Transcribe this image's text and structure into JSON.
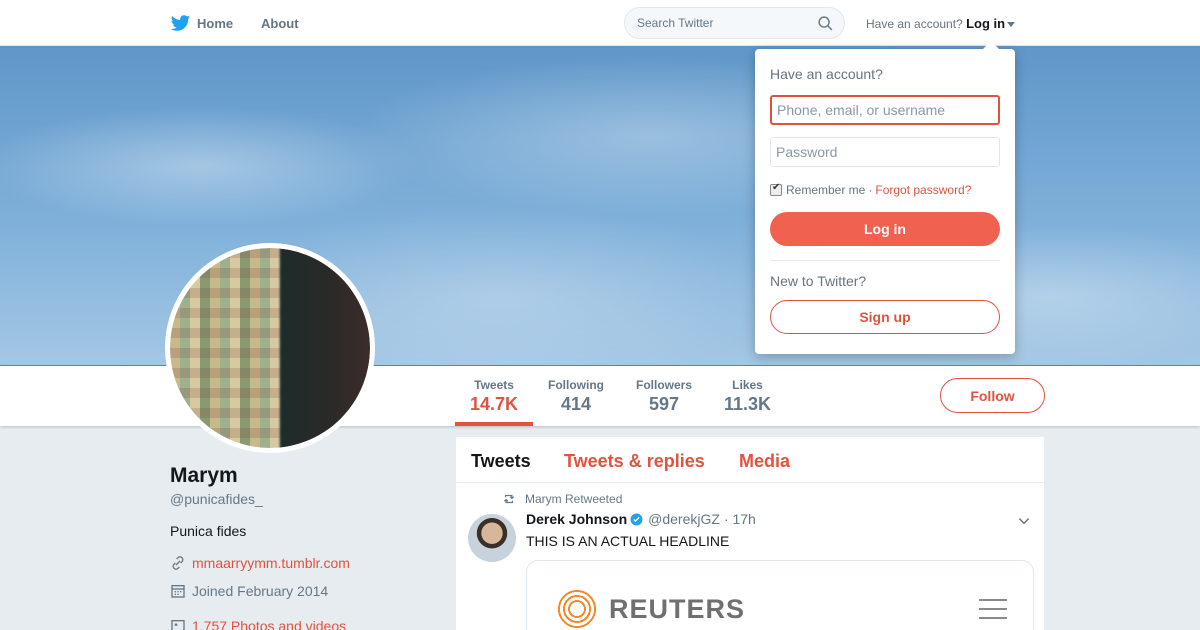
{
  "nav": {
    "home_label": "Home",
    "about_label": "About",
    "search_placeholder": "Search Twitter",
    "have_account": "Have an account?",
    "login_label": "Log in"
  },
  "profile": {
    "name": "Marym",
    "handle": "@punicafides_",
    "bio": "Punica fides",
    "website": "mmaarryymm.tumblr.com",
    "joined": "Joined February 2014",
    "photos": "1,757 Photos and videos"
  },
  "stats": [
    {
      "label": "Tweets",
      "value": "14.7K"
    },
    {
      "label": "Following",
      "value": "414"
    },
    {
      "label": "Followers",
      "value": "597"
    },
    {
      "label": "Likes",
      "value": "11.3K"
    }
  ],
  "follow_label": "Follow",
  "timeline": {
    "tabs": [
      "Tweets",
      "Tweets & replies",
      "Media"
    ],
    "retweet_note": "Marym Retweeted",
    "tweet": {
      "author": "Derek Johnson",
      "handle": "@derekjGZ",
      "time": "· 17h",
      "text": "THIS IS AN ACTUAL HEADLINE",
      "card_brand": "REUTERS"
    }
  },
  "login_dropdown": {
    "title": "Have an account?",
    "username_placeholder": "Phone, email, or username",
    "password_placeholder": "Password",
    "remember_label": "Remember me",
    "separator": "·",
    "forgot_label": "Forgot password?",
    "login_button": "Log in",
    "new_label": "New to Twitter?",
    "signup_button": "Sign up"
  },
  "colors": {
    "accent": "#e0533f",
    "twitter_blue": "#1da1f2"
  }
}
